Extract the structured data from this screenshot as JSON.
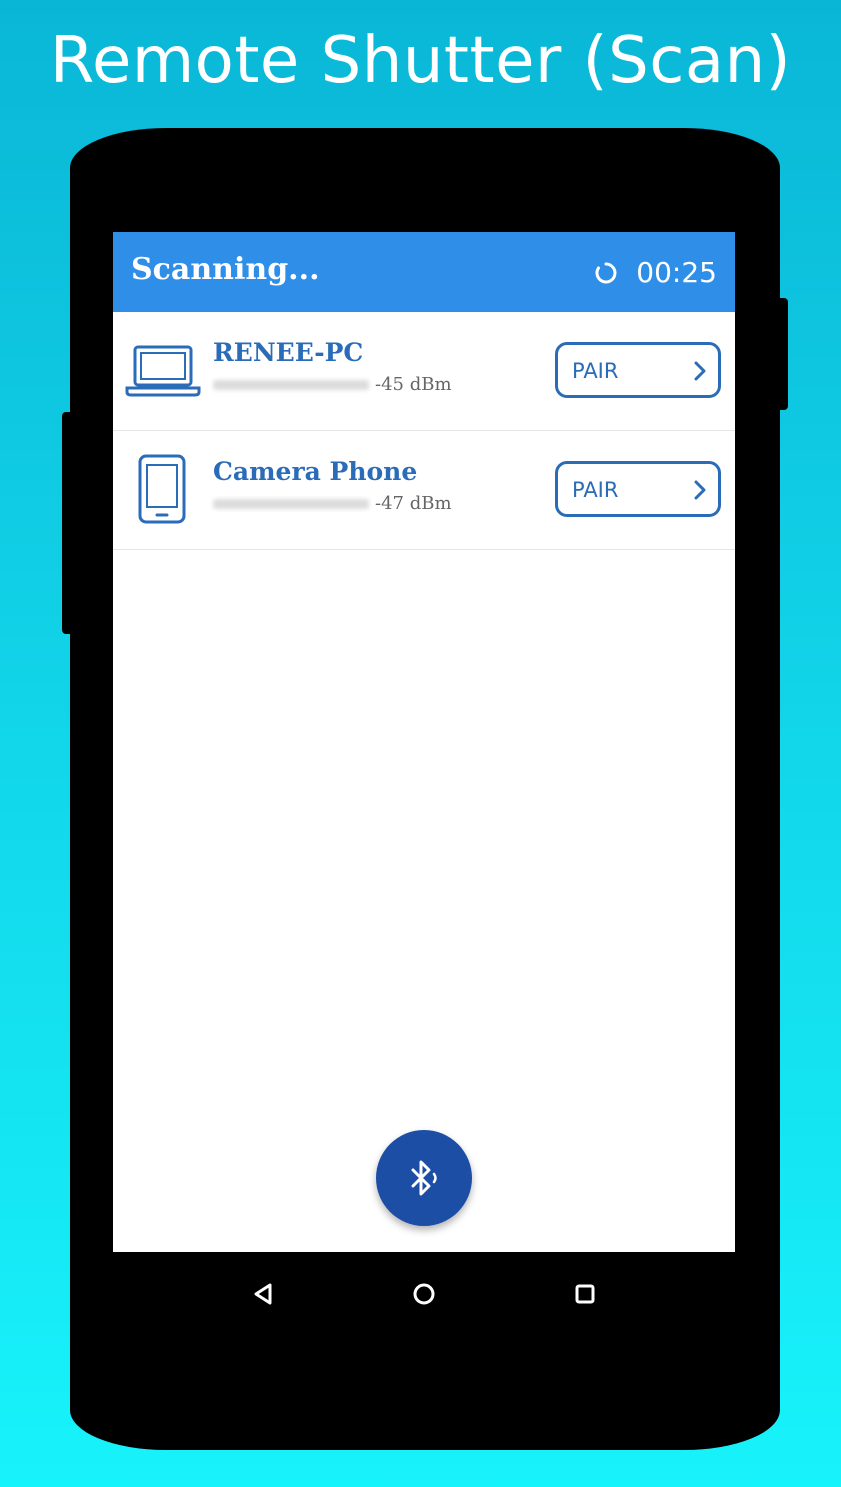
{
  "promo": {
    "title": "Remote Shutter (Scan)"
  },
  "app_bar": {
    "title": "Scanning...",
    "timer": "00:25",
    "spinner_icon": "spinner-icon",
    "color": "#2e8ee8"
  },
  "devices": [
    {
      "name": "RENEE-PC",
      "signal": "-45 dBm",
      "icon": "laptop-icon",
      "pair_label": "PAIR"
    },
    {
      "name": "Camera Phone",
      "signal": "-47 dBm",
      "icon": "phone-icon",
      "pair_label": "PAIR"
    }
  ],
  "fab": {
    "icon": "bluetooth-searching-icon",
    "color": "#1d4ea6"
  },
  "nav_bar": {
    "back_icon": "back-icon",
    "home_icon": "home-icon",
    "recents_icon": "recents-icon"
  },
  "colors": {
    "accent": "#2a6cb8",
    "background_top": "#0ab6d6",
    "background_bottom": "#17f3fb"
  }
}
